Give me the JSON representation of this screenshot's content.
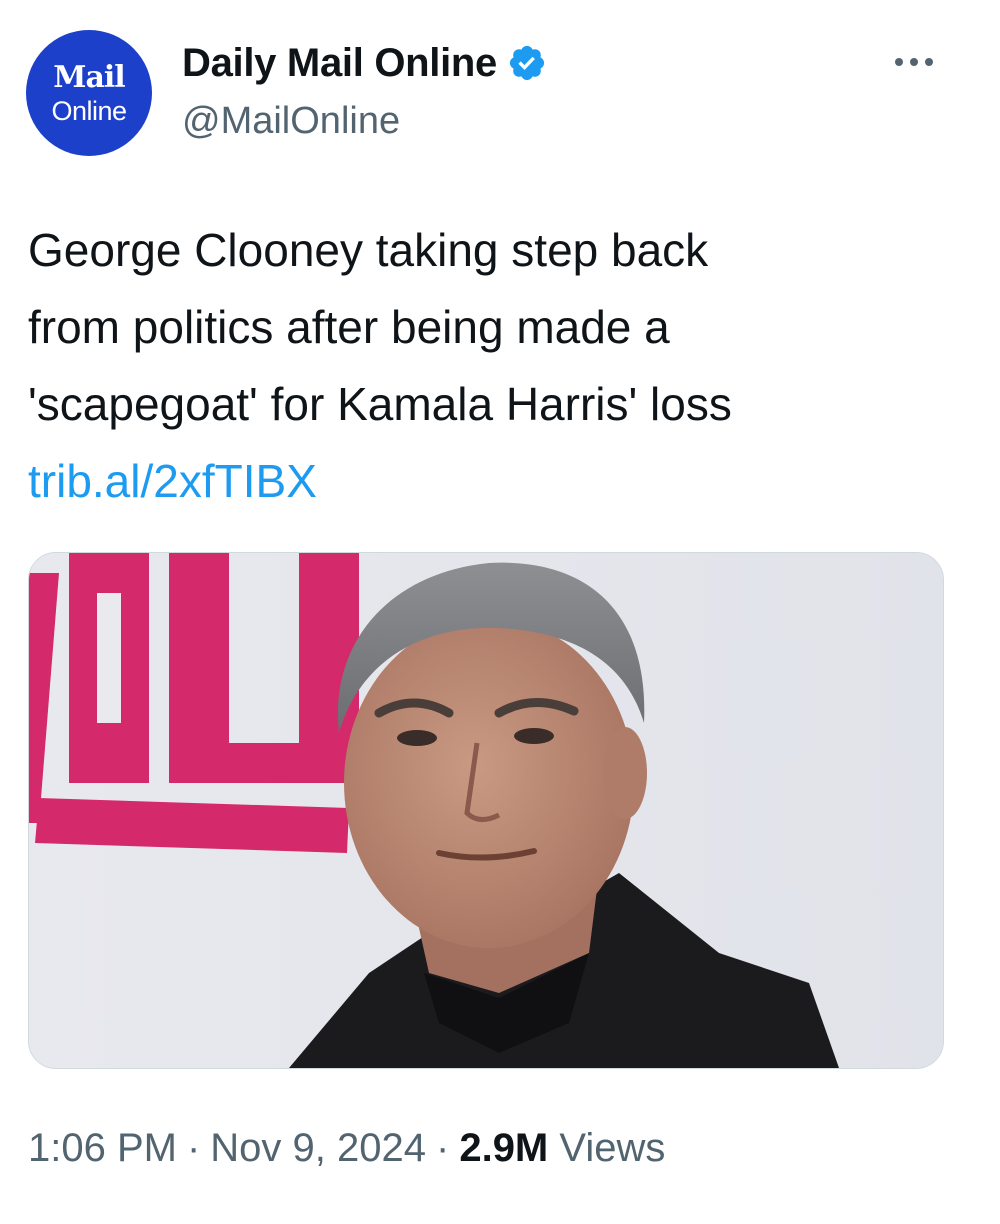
{
  "account": {
    "display_name": "Daily Mail Online",
    "handle": "@MailOnline",
    "verified": true,
    "avatar_logo_top": "Mail",
    "avatar_logo_bottom": "Online",
    "avatar_color": "#1c40c9"
  },
  "tweet": {
    "text_lines": [
      "George Clooney taking step back",
      "from politics after being made a",
      "'scapegoat' for Kamala Harris' loss"
    ],
    "link": "trib.al/2xfTIBX"
  },
  "meta": {
    "time": "1:06 PM",
    "separator": "·",
    "date": "Nov 9, 2024",
    "views_count": "2.9M",
    "views_label": "Views"
  },
  "icons": {
    "verified": "verified-badge-icon",
    "more": "more-options-icon"
  },
  "colors": {
    "link": "#1d9bf0",
    "secondary_text": "#536471",
    "verified": "#1d9bf0"
  }
}
